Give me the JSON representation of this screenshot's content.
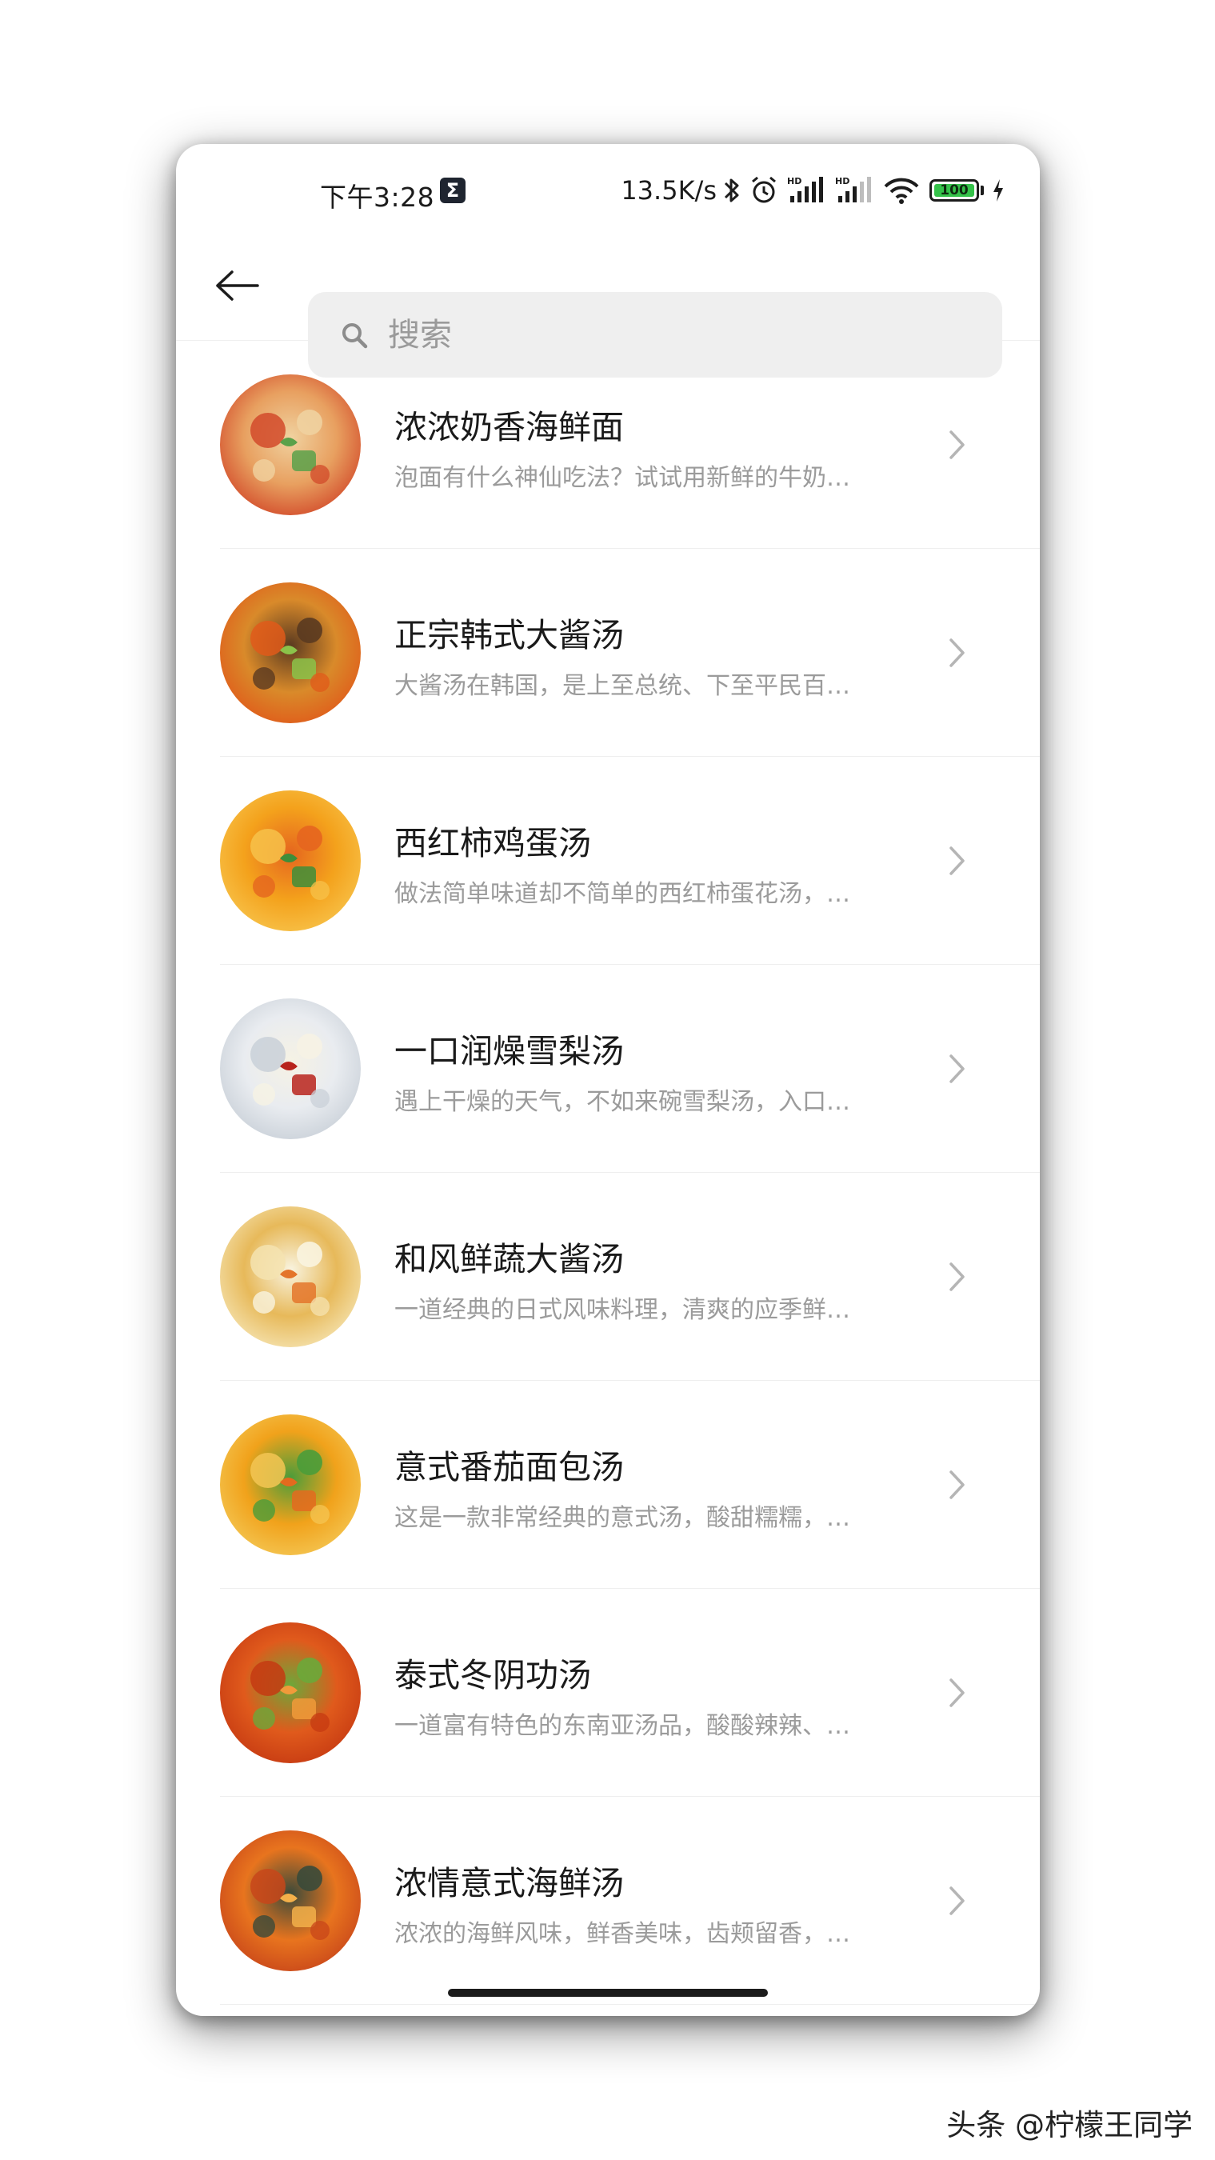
{
  "status_bar": {
    "time": "下午3:28",
    "notification_badge": "Σ",
    "network_speed": "13.5K/s",
    "battery_level": "100",
    "icons": [
      "bluetooth-icon",
      "alarm-icon",
      "hd-signal-icon",
      "hd-signal-icon",
      "wifi-icon",
      "battery-icon",
      "charging-icon"
    ]
  },
  "header": {
    "back_icon": "back-arrow-icon",
    "search_placeholder": "搜索",
    "search_icon": "search-icon"
  },
  "items": [
    {
      "title": "浓浓奶香海鲜面",
      "desc": "泡面有什么神仙吃法？试试用新鲜的牛奶…",
      "image": "seafood-noodle-image",
      "palette": [
        "#e8a060",
        "#d24a2a",
        "#5aa14a",
        "#f0d2a0"
      ]
    },
    {
      "title": "正宗韩式大酱汤",
      "desc": "大酱汤在韩国，是上至总统、下至平民百…",
      "image": "korean-soybean-soup-image",
      "palette": [
        "#d98a2a",
        "#e05a1a",
        "#8bc34a",
        "#5a3a20"
      ]
    },
    {
      "title": "西红柿鸡蛋汤",
      "desc": "做法简单味道却不简单的西红柿蛋花汤，…",
      "image": "tomato-egg-soup-image",
      "palette": [
        "#f4a21c",
        "#f7c24a",
        "#3e8e3a",
        "#e5651f"
      ]
    },
    {
      "title": "一口润燥雪梨汤",
      "desc": "遇上干燥的天气，不如来碗雪梨汤，入口…",
      "image": "pear-soup-image",
      "palette": [
        "#e9ecf0",
        "#c9d0d8",
        "#b8231c",
        "#f6f2e4"
      ]
    },
    {
      "title": "和风鲜蔬大酱汤",
      "desc": "一道经典的日式风味料理，清爽的应季鲜…",
      "image": "japanese-miso-soup-image",
      "palette": [
        "#e7b95a",
        "#f5e3b0",
        "#e4752a",
        "#f9f4e0"
      ]
    },
    {
      "title": "意式番茄面包汤",
      "desc": "这是一款非常经典的意式汤，酸甜糯糯，…",
      "image": "italian-tomato-bread-soup-image",
      "palette": [
        "#f1a21b",
        "#f4c653",
        "#e46a1e",
        "#4a9c3a"
      ]
    },
    {
      "title": "泰式冬阴功汤",
      "desc": "一道富有特色的东南亚汤品，酸酸辣辣、…",
      "image": "tom-yum-soup-image",
      "palette": [
        "#e05a1c",
        "#c63a12",
        "#f19a3a",
        "#6ca83a"
      ]
    },
    {
      "title": "浓情意式海鲜汤",
      "desc": "浓浓的海鲜风味，鲜香美味，齿颊留香，…",
      "image": "italian-seafood-soup-image",
      "palette": [
        "#e8741e",
        "#c8461a",
        "#f3b04a",
        "#3a4a3a"
      ]
    }
  ],
  "watermark": "头条 @柠檬王同学"
}
